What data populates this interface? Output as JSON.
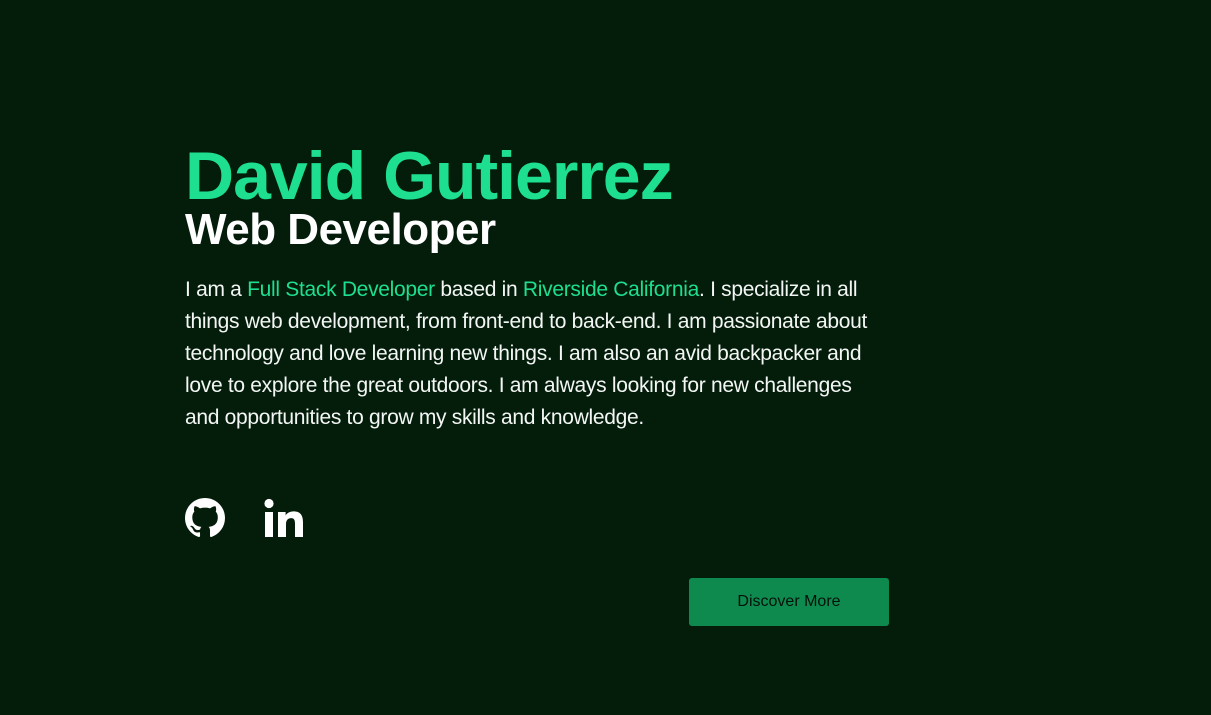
{
  "colors": {
    "background": "#041d0b",
    "accent": "#1ddf8f",
    "text": "#ffffff",
    "button_bg": "#0f8a4e",
    "button_text": "#04120a"
  },
  "hero": {
    "name": "David Gutierrez",
    "role": "Web Developer",
    "bio": {
      "intro": "I am a ",
      "role_highlight": "Full Stack Developer",
      "based_in": " based in ",
      "location_highlight": "Riverside California",
      "rest": ". I specialize in all things web development, from front-end to back-end. I am passionate about technology and love learning new things. I am also an avid backpacker and love to explore the great outdoors. I am always looking for new challenges and opportunities to grow my skills and knowledge."
    }
  },
  "socials": [
    {
      "icon": "github-icon"
    },
    {
      "icon": "linkedin-icon"
    }
  ],
  "cta": {
    "label": "Discover More"
  }
}
